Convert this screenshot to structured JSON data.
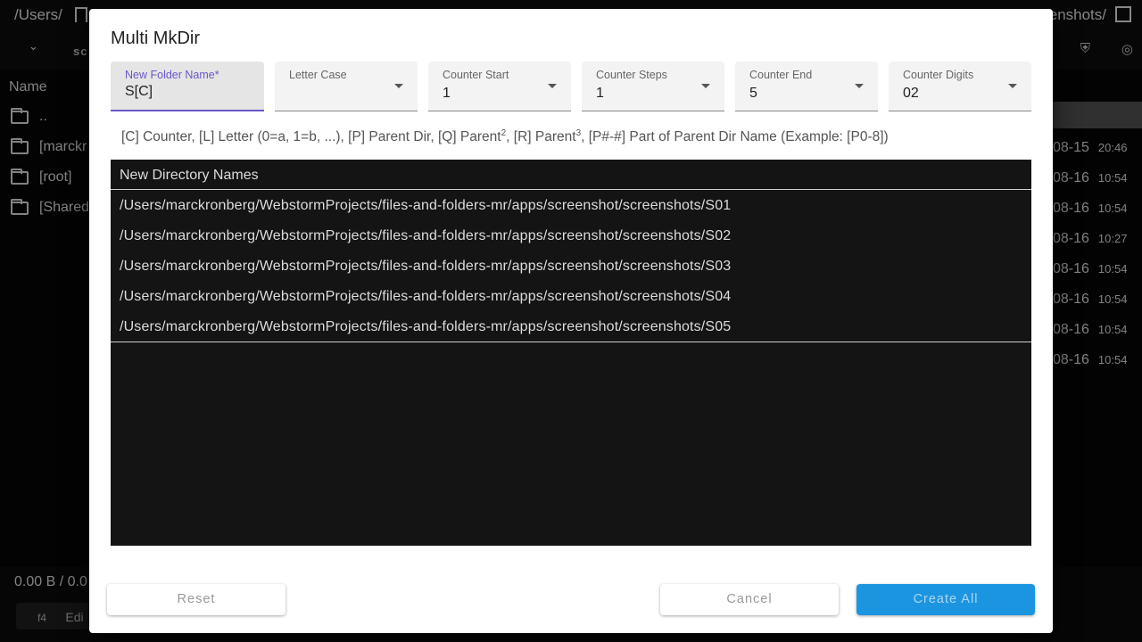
{
  "background": {
    "path_left": "/Users/",
    "path_right": "enshots/",
    "toolbar_sc": "sc",
    "column_name": "Name",
    "rows": [
      {
        "label": ".."
      },
      {
        "label": "[marckr"
      },
      {
        "label": "[root]"
      },
      {
        "label": "[Shared"
      }
    ],
    "dates": [
      {
        "date": "08-15",
        "time": "20:46"
      },
      {
        "date": "08-16",
        "time": "10:54"
      },
      {
        "date": "08-16",
        "time": "10:54"
      },
      {
        "date": "08-16",
        "time": "10:27"
      },
      {
        "date": "08-16",
        "time": "10:54"
      },
      {
        "date": "08-16",
        "time": "10:54"
      },
      {
        "date": "08-16",
        "time": "10:54"
      },
      {
        "date": "08-16",
        "time": "10:54"
      }
    ],
    "status": "0.00 B / 0.0",
    "fkey": "f4",
    "fkey_label": "Edi"
  },
  "dialog": {
    "title": "Multi MkDir",
    "fields": {
      "folder_name": {
        "label": "New Folder Name*",
        "value": "S[C]"
      },
      "letter_case": {
        "label": "Letter Case",
        "value": ""
      },
      "counter_start": {
        "label": "Counter Start",
        "value": "1"
      },
      "counter_steps": {
        "label": "Counter Steps",
        "value": "1"
      },
      "counter_end": {
        "label": "Counter End",
        "value": "5"
      },
      "counter_digits": {
        "label": "Counter Digits",
        "value": "02"
      }
    },
    "help": {
      "part1": "[C] Counter, [L] Letter (0=a, 1=b, ...), [P] Parent Dir, [Q] Parent",
      "sup1": "2",
      "part2": ", [R] Parent",
      "sup2": "3",
      "part3": ", [P#-#] Part of Parent Dir Name (Example: [P0-8])"
    },
    "table": {
      "header": "New Directory Names",
      "rows": [
        "/Users/marckronberg/WebstormProjects/files-and-folders-mr/apps/screenshot/screenshots/S01",
        "/Users/marckronberg/WebstormProjects/files-and-folders-mr/apps/screenshot/screenshots/S02",
        "/Users/marckronberg/WebstormProjects/files-and-folders-mr/apps/screenshot/screenshots/S03",
        "/Users/marckronberg/WebstormProjects/files-and-folders-mr/apps/screenshot/screenshots/S04",
        "/Users/marckronberg/WebstormProjects/files-and-folders-mr/apps/screenshot/screenshots/S05"
      ]
    },
    "buttons": {
      "reset": "Reset",
      "cancel": "Cancel",
      "create_all": "Create All"
    }
  },
  "colors": {
    "accent": "#6a57c8",
    "primary_button": "#1c95e0"
  }
}
